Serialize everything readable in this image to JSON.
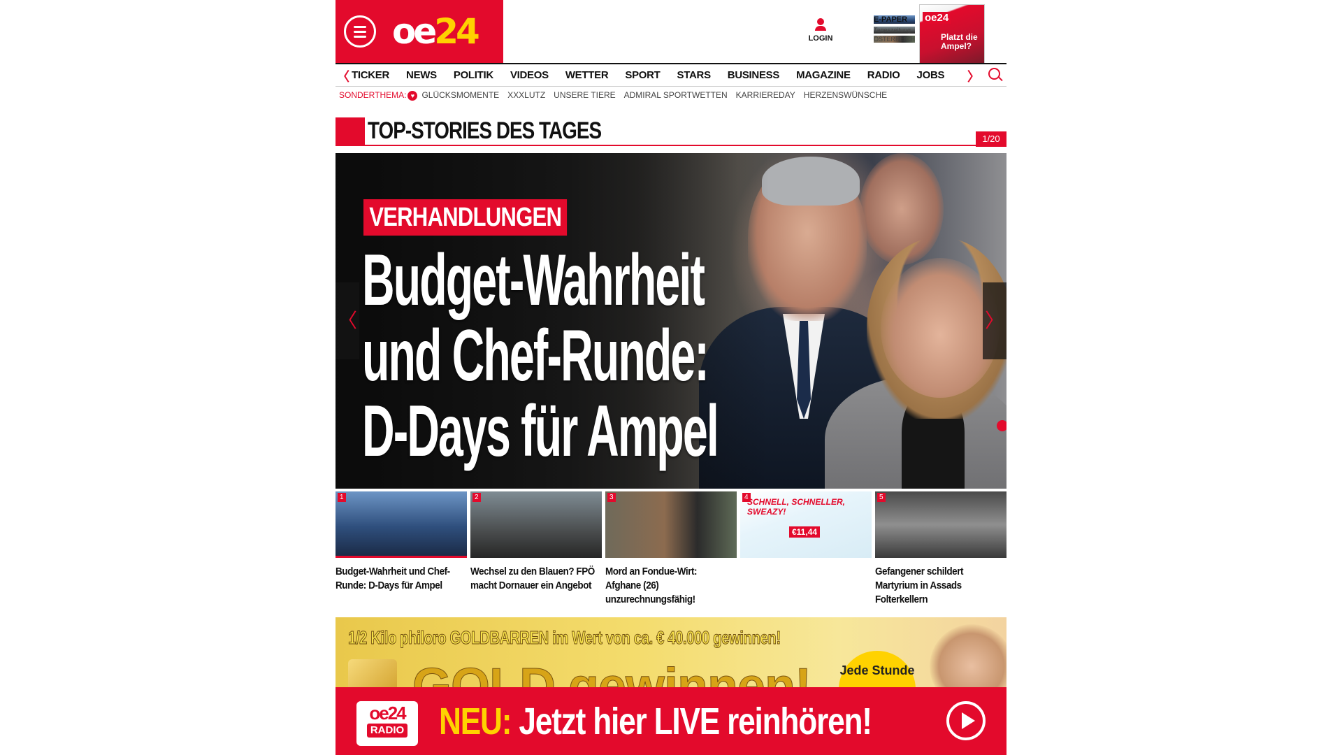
{
  "header": {
    "logo_text_main": "oe",
    "logo_text_accent": "24",
    "login_label": "LOGIN",
    "epaper_title": "E-PAPER",
    "epaper_sub1": "Tageszeitung",
    "epaper_sub2": "ÖSTERREICH",
    "epaper_cover_logo": "oe24",
    "epaper_cover_headline": "Platzt die Ampel?"
  },
  "nav": {
    "items": [
      "TICKER",
      "NEWS",
      "POLITIK",
      "VIDEOS",
      "WETTER",
      "SPORT",
      "STARS",
      "BUSINESS",
      "MAGAZINE",
      "RADIO",
      "JOBS"
    ],
    "prev_arrow": "〈",
    "next_arrow": "〉"
  },
  "subnav": {
    "label": "SONDERTHEMA:",
    "items": [
      "GLÜCKSMOMENTE",
      "XXXLUTZ",
      "UNSERE TIERE",
      "ADMIRAL SPORTWETTEN",
      "KARRIEREDAY",
      "HERZENSWÜNSCHE"
    ]
  },
  "section": {
    "title": "TOP-STORIES DES TAGES",
    "counter": "1/20"
  },
  "hero": {
    "kicker": "VERHANDLUNGEN",
    "headline_lines": [
      "Budget-Wahrheit",
      "und Chef-Runde:",
      "D-Days für Ampel"
    ],
    "prev": "〈",
    "next": "〉"
  },
  "stories": [
    {
      "num": "1",
      "caption": "Budget-Wahrheit und Chef-Runde: D-Days für Ampel"
    },
    {
      "num": "2",
      "caption": "Wechsel zu den Blauen? FPÖ macht Dornauer ein Angebot"
    },
    {
      "num": "3",
      "caption": "Mord an Fondue-Wirt: Afghane (26) unzurechnungsfähig!"
    },
    {
      "num": "4",
      "caption": "",
      "ad_text": "SCHNELL, SCHNELLER, SWEAZY!",
      "ad_price": "€11,44"
    },
    {
      "num": "5",
      "caption": "Gefangener schildert Martyrium in Assads Folterkellern"
    }
  ],
  "gold_banner": {
    "line1": "1/2 Kilo philoro GOLDBARREN im Wert von ca. € 40.000 gewinnen!",
    "big": "GOLD gewinnen!",
    "badge": "Jede Stunde"
  },
  "radio_banner": {
    "logo_top": "oe24",
    "logo_bottom": "RADIO",
    "neu": "NEU:",
    "text": "Jetzt hier LIVE reinhören!"
  }
}
